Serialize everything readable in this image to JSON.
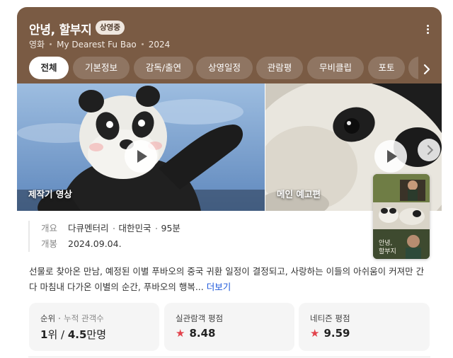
{
  "header": {
    "title": "안녕, 할부지",
    "badge": "상영중",
    "meta": {
      "type": "영화",
      "english_title": "My Dearest Fu Bao",
      "year": "2024"
    }
  },
  "tabs": [
    {
      "label": "전체",
      "active": true
    },
    {
      "label": "기본정보",
      "active": false
    },
    {
      "label": "감독/출연",
      "active": false
    },
    {
      "label": "상영일정",
      "active": false
    },
    {
      "label": "관람평",
      "active": false
    },
    {
      "label": "무비클립",
      "active": false
    },
    {
      "label": "포토",
      "active": false
    },
    {
      "label": "",
      "active": false
    }
  ],
  "videos": [
    {
      "label": "제작기 영상"
    },
    {
      "label": "메인 예고편"
    }
  ],
  "info": {
    "overview_key": "개요",
    "genre": "다큐멘터리",
    "country": "대한민국",
    "runtime": "95분",
    "release_key": "개봉",
    "release_date": "2024.09.04."
  },
  "synopsis": {
    "text": "선물로 찾아온 만남, 예정된 이별 푸바오의 중국 귀환 일정이 결정되고, 사랑하는 이들의 아쉬움이 커져만 간다 마침내 다가온 이별의 순간, 푸바오의 행복...",
    "more": "더보기"
  },
  "stats": {
    "rank": {
      "label": "순위",
      "sub_label": "누적 관객수",
      "rank_num": "1",
      "rank_unit": "위",
      "audience_num": "4.5",
      "audience_unit": "만명"
    },
    "audience_rating": {
      "label": "실관람객 평점",
      "score": "8.48"
    },
    "netizen_rating": {
      "label": "네티즌 평점",
      "score": "9.59"
    }
  },
  "colors": {
    "header_bg": "#7a5b44",
    "star": "#e2424b",
    "link": "#1a56db"
  }
}
